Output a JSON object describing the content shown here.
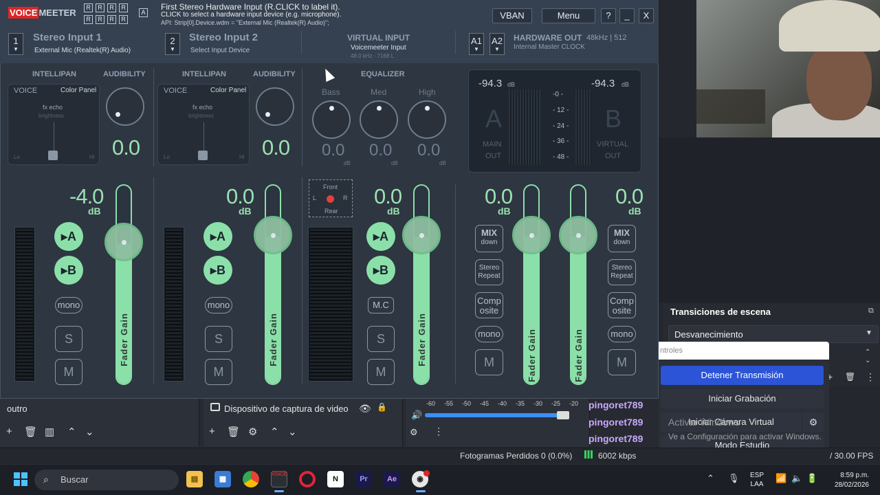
{
  "vm": {
    "logo_a": "VOICE",
    "logo_b": "MEETER",
    "r_labels": [
      "R",
      "R",
      "R",
      "R",
      "R",
      "R",
      "R",
      "R",
      "R",
      "R",
      "R",
      "R",
      "A"
    ],
    "help_title": "First Stereo Hardware Input (R.CLICK to label it).",
    "help_line2": "CLICK to select a hardware input device (e.g. microphone).",
    "help_line3": "API: Strip[0].Device.wdm = \"External Mic (Realtek(R) Audio)\";",
    "vban": "VBAN",
    "menu": "Menu",
    "help_btn": "?",
    "min_btn": "_",
    "close_btn": "X",
    "strip1": {
      "num": "1",
      "title": "Stereo Input 1",
      "device": "External Mic (Realtek(R) Audio)"
    },
    "strip2": {
      "num": "2",
      "title": "Stereo Input 2",
      "device": "Select Input Device"
    },
    "virtual": {
      "title": "VIRTUAL INPUT",
      "name": "Voicemeeter Input",
      "info": "48.0 kHz - 7168 L"
    },
    "hw": {
      "a1": "A1",
      "a2": "A2",
      "title": "HARDWARE OUT",
      "rate": "48kHz | 512",
      "clock": "Internal Master CLOCK"
    },
    "labels": {
      "intellipan": "INTELLIPAN",
      "audibility": "AUDIBILITY",
      "equalizer": "EQUALIZER",
      "voice": "VOICE",
      "color_panel": "Color Panel",
      "fx_echo": "fx echo",
      "brightness": "brightness",
      "lo": "Lo",
      "hi": "Hi",
      "bass": "Bass",
      "med": "Med",
      "high": "High",
      "db": "dB",
      "front": "Front",
      "rear": "Rear",
      "l": "L",
      "r": "R"
    },
    "aud1": "0.0",
    "aud2": "0.0",
    "eq": {
      "bass": "0.0",
      "med": "0.0",
      "high": "0.0"
    },
    "meter": {
      "left_val": "-94.3",
      "right_val": "-94.3",
      "unit": "dB",
      "a": "A",
      "b": "B",
      "main_out_1": "MAIN",
      "main_out_2": "OUT",
      "virtual_out_1": "VIRTUAL",
      "virtual_out_2": "OUT",
      "scale": [
        "-0 -",
        "- 12 -",
        "- 24 -",
        "- 36 -",
        "- 48 -"
      ]
    },
    "gain1": "-4.0",
    "gain2": "0.0",
    "gain3": "0.0",
    "gain4": "0.0",
    "gain5": "0.0",
    "btn_a": "A",
    "btn_b": "B",
    "mono": "mono",
    "mc": "M.C",
    "solo": "S",
    "mute": "M",
    "fader_gain": "Fader Gain",
    "mix": "MIX",
    "mix_down": "down",
    "stereo_1": "Stereo",
    "stereo_2": "Repeat",
    "comp_1": "Comp",
    "comp_2": "osite"
  },
  "obs": {
    "scene": "outro",
    "source": "Dispositivo de captura de video",
    "transitions_title": "Transiciones de escena",
    "transition": "Desvanecimiento",
    "controls": "ntroles",
    "btn_stream": "Detener Transmisión",
    "btn_rec": "Iniciar Grabación",
    "btn_cam": "Iniciar Cámara Virtual",
    "btn_studio": "Modo Estudio",
    "activate_1": "Activar Windows",
    "activate_2": "Ve a Configuración para activar Windows.",
    "dropped": "Fotogramas Perdidos 0 (0.0%)",
    "bitrate": "6002 kbps",
    "fps": "/ 30.00 FPS",
    "scale": [
      "-60",
      "-55",
      "-50",
      "-45",
      "-40",
      "-35",
      "-30",
      "-25",
      "-20"
    ],
    "chat": [
      "pingoret789",
      "pingoret789",
      "pingoret789"
    ],
    "volume_fraction": 0.97
  },
  "taskbar": {
    "search": "Buscar",
    "lang_1": "ESP",
    "lang_2": "LAA",
    "time": "8:59 p.m.",
    "date": "28/02/2026",
    "apps": [
      "explorer",
      "store",
      "chrome",
      "voicemeeter",
      "opera",
      "notion",
      "premiere",
      "after-effects",
      "obs"
    ]
  },
  "colors": {
    "accent_green": "#8be0a9",
    "stream_blue": "#2b54d6",
    "chat_purple": "#c9a8ff",
    "vm_red": "#e02525"
  }
}
